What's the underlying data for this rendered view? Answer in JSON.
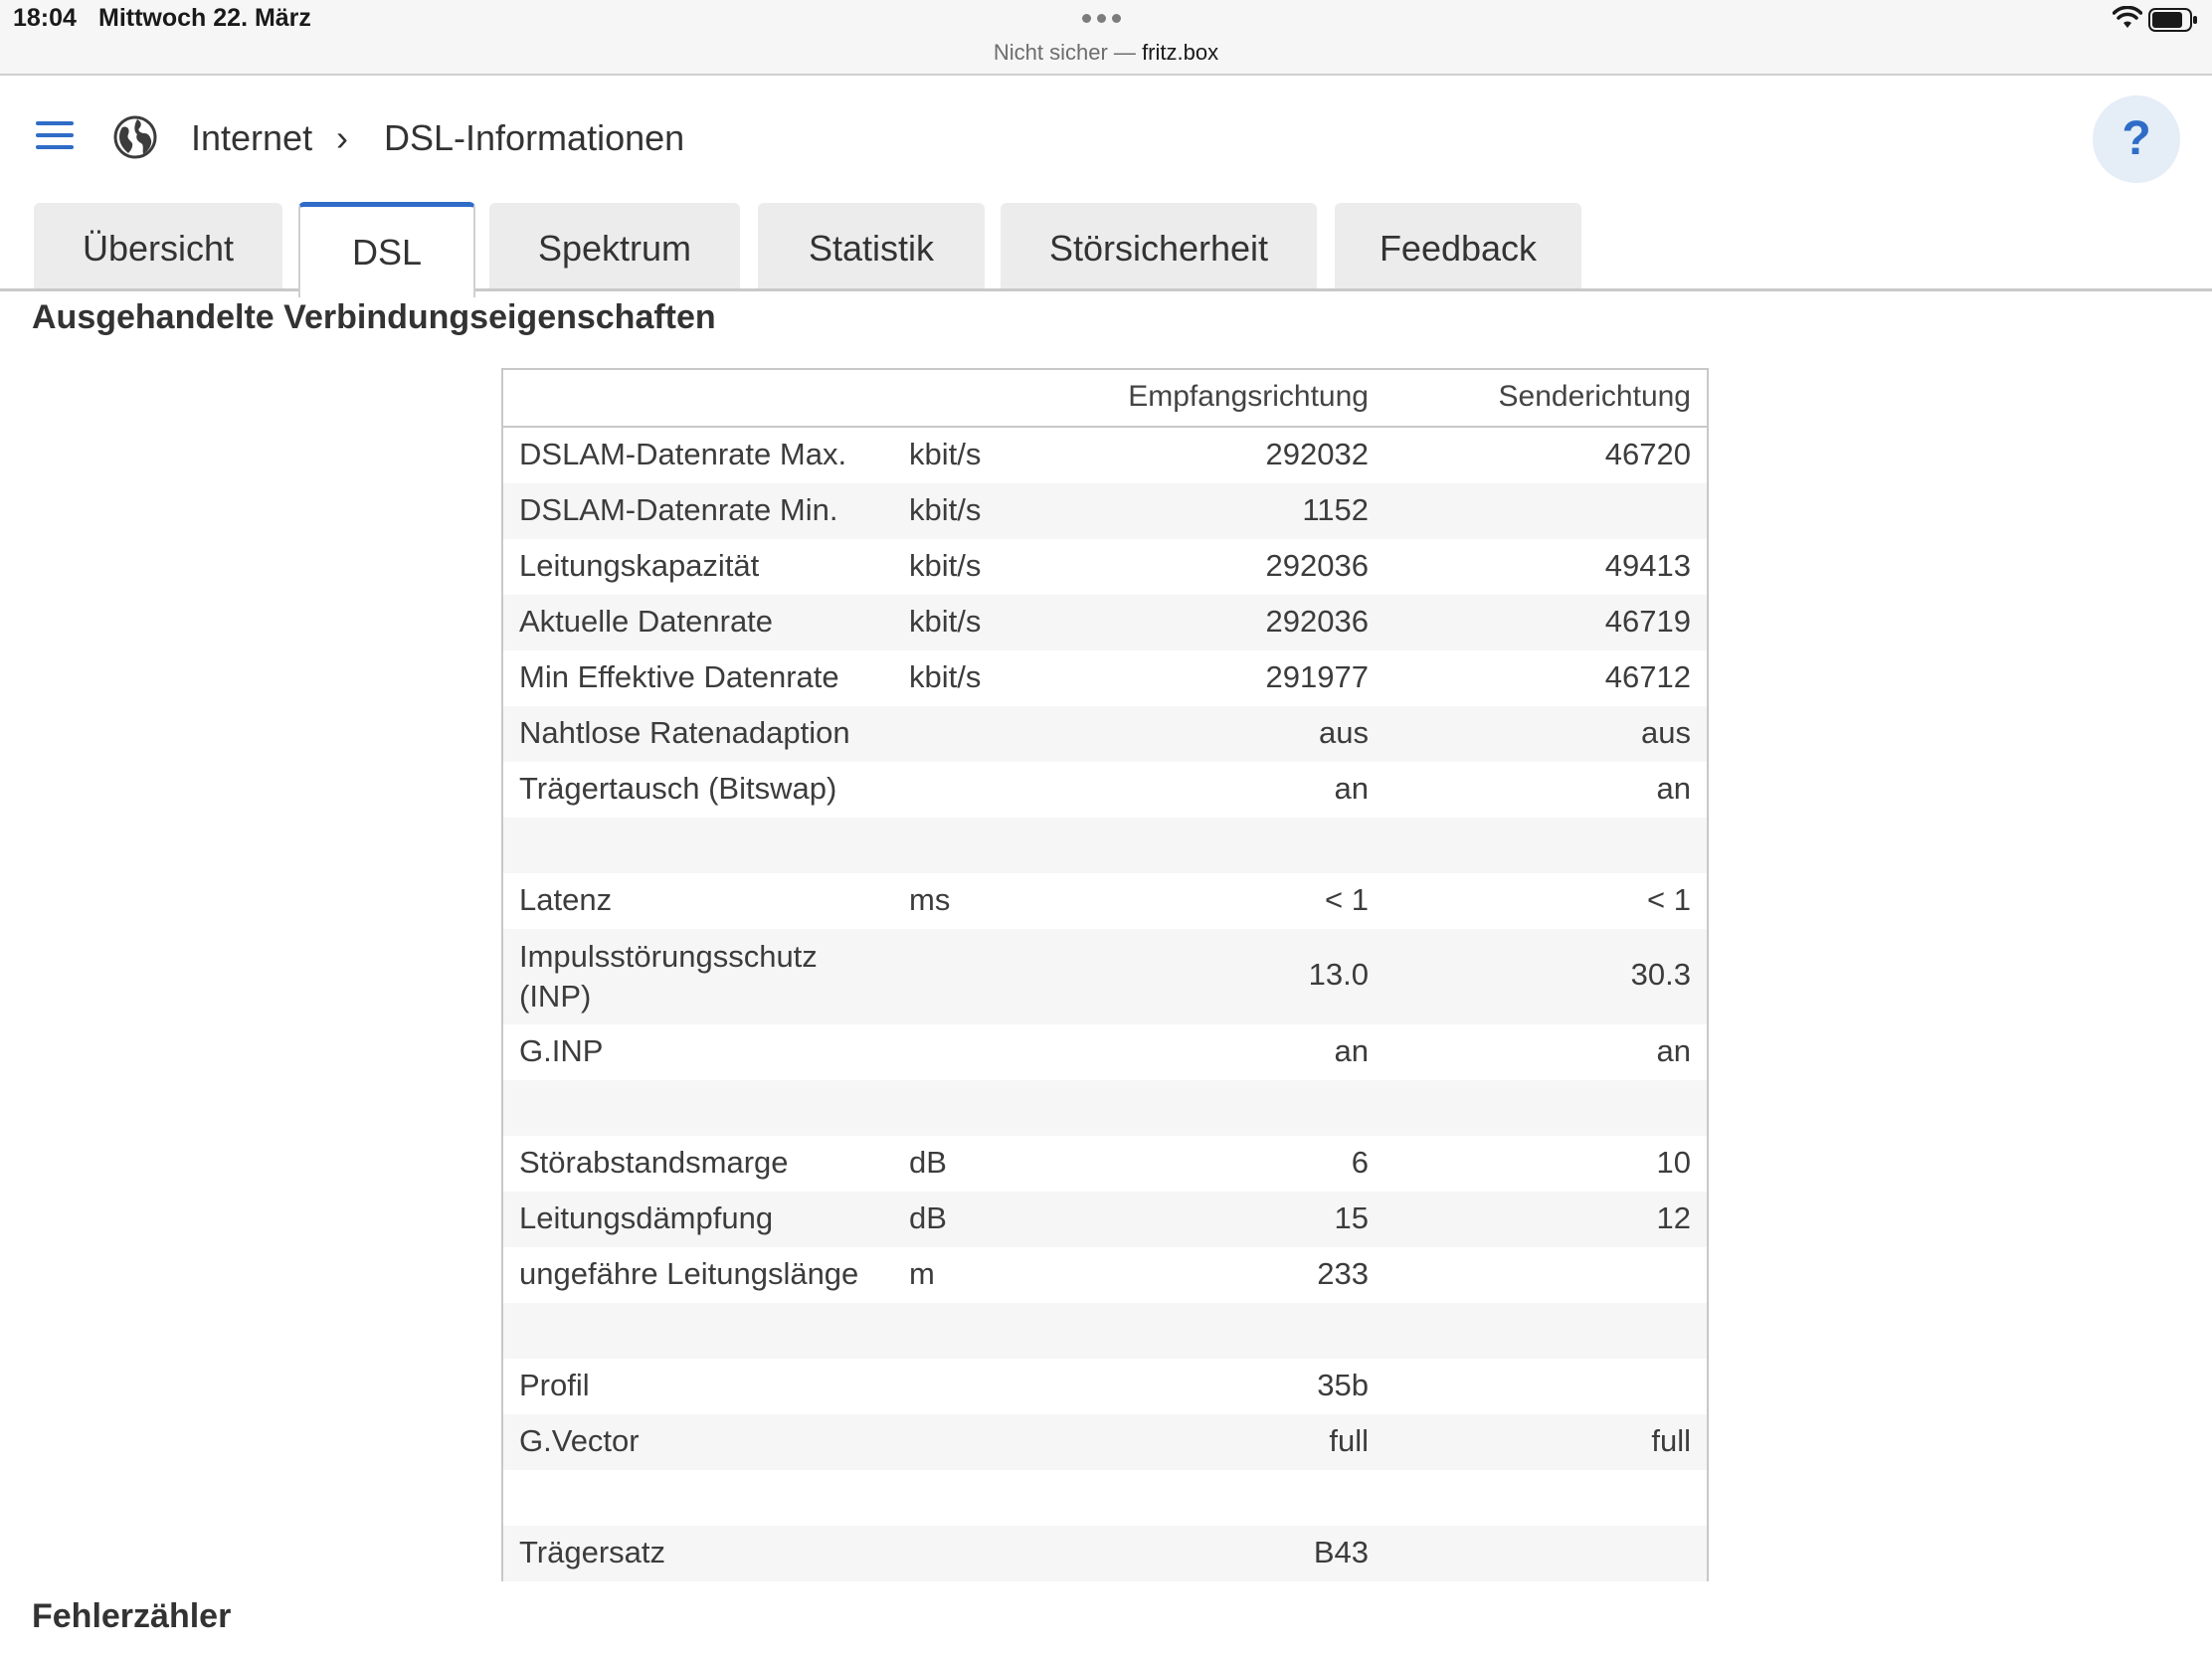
{
  "status_bar": {
    "time": "18:04",
    "date": "Mittwoch 22. März",
    "url_prefix": "Nicht sicher —",
    "url_host": "fritz.box"
  },
  "header": {
    "breadcrumb_section": "Internet",
    "breadcrumb_separator": "›",
    "breadcrumb_page": "DSL-Informationen",
    "help_label": "?"
  },
  "tabs": [
    {
      "label": "Übersicht"
    },
    {
      "label": "DSL"
    },
    {
      "label": "Spektrum"
    },
    {
      "label": "Statistik"
    },
    {
      "label": "Störsicherheit"
    },
    {
      "label": "Feedback"
    }
  ],
  "active_tab": "DSL",
  "section_title": "Ausgehandelte Verbindungseigenschaften",
  "table": {
    "col_down": "Empfangsrichtung",
    "col_up": "Senderichtung",
    "rows": [
      {
        "label": "DSLAM-Datenrate Max.",
        "unit": "kbit/s",
        "down": "292032",
        "up": "46720"
      },
      {
        "label": "DSLAM-Datenrate Min.",
        "unit": "kbit/s",
        "down": "1152",
        "up": ""
      },
      {
        "label": "Leitungskapazität",
        "unit": "kbit/s",
        "down": "292036",
        "up": "49413"
      },
      {
        "label": "Aktuelle Datenrate",
        "unit": "kbit/s",
        "down": "292036",
        "up": "46719"
      },
      {
        "label": "Min Effektive Datenrate",
        "unit": "kbit/s",
        "down": "291977",
        "up": "46712"
      },
      {
        "label": "Nahtlose Ratenadaption",
        "unit": "",
        "down": "aus",
        "up": "aus"
      },
      {
        "label": "Trägertausch (Bitswap)",
        "unit": "",
        "down": "an",
        "up": "an"
      },
      {
        "label": "",
        "unit": "",
        "down": "",
        "up": ""
      },
      {
        "label": "Latenz",
        "unit": "ms",
        "down": "< 1",
        "up": "< 1"
      },
      {
        "label": "Impulsstörungsschutz (INP)",
        "unit": "",
        "down": "13.0",
        "up": "30.3"
      },
      {
        "label": "G.INP",
        "unit": "",
        "down": "an",
        "up": "an"
      },
      {
        "label": "",
        "unit": "",
        "down": "",
        "up": ""
      },
      {
        "label": "Störabstandsmarge",
        "unit": "dB",
        "down": "6",
        "up": "10"
      },
      {
        "label": "Leitungsdämpfung",
        "unit": "dB",
        "down": "15",
        "up": "12"
      },
      {
        "label": "ungefähre Leitungslänge",
        "unit": "m",
        "down": "233",
        "up": ""
      },
      {
        "label": "",
        "unit": "",
        "down": "",
        "up": ""
      },
      {
        "label": "Profil",
        "unit": "",
        "down": "35b",
        "up": ""
      },
      {
        "label": "G.Vector",
        "unit": "",
        "down": "full",
        "up": "full"
      },
      {
        "label": "",
        "unit": "",
        "down": "",
        "up": ""
      },
      {
        "label": "Trägersatz",
        "unit": "",
        "down": "B43",
        "up": ""
      }
    ]
  },
  "section2_title": "Fehlerzähler",
  "colors": {
    "accent": "#2f6cc7",
    "tab_inactive": "#ececec",
    "row_alt": "#f6f6f6",
    "help_bg": "#e5edf7"
  }
}
